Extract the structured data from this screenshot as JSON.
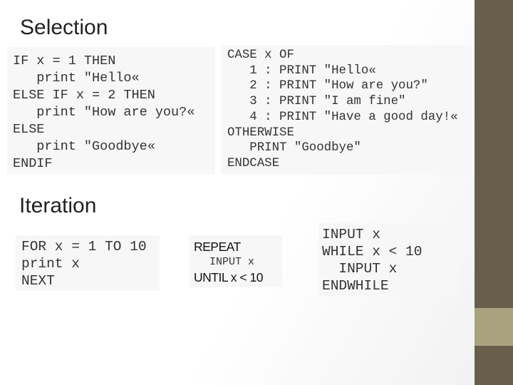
{
  "headings": {
    "selection": "Selection",
    "iteration": "Iteration"
  },
  "if_block": [
    "IF x = 1 THEN",
    "   print \"Hello«",
    "ELSE IF x = 2 THEN",
    "   print \"How are you?«",
    "ELSE",
    "   print \"Goodbye«",
    "ENDIF"
  ],
  "case_block": [
    "CASE x OF",
    "   1 : PRINT \"Hello«",
    "   2 : PRINT \"How are you?\"",
    "   3 : PRINT \"I am fine\"",
    "   4 : PRINT \"Have a good day!«",
    "OTHERWISE",
    "   PRINT \"Goodbye\"",
    "ENDCASE"
  ],
  "for_block": [
    "FOR x = 1 TO 10",
    "print x",
    "NEXT"
  ],
  "repeat_block": {
    "start": "REPEAT",
    "body": "INPUT x",
    "end": "UNTIL x < 10"
  },
  "while_block": [
    "INPUT x",
    "WHILE x < 10",
    "  INPUT x",
    "ENDWHILE"
  ],
  "colors": {
    "sidebar": "#675f4b",
    "sidebar_band": "#a9a27f"
  }
}
